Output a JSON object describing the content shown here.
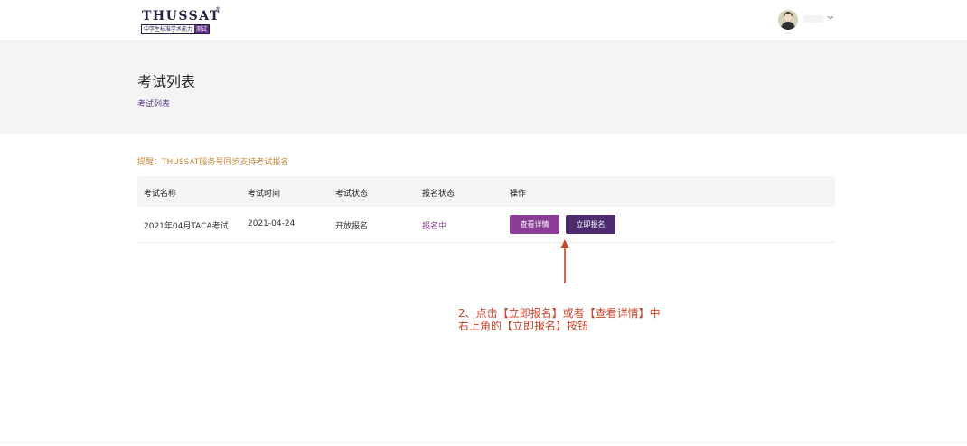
{
  "header": {
    "logo": {
      "brand": "THUSSAT",
      "registered": "®",
      "subtitle": "中学生标准学术能力",
      "subtitle_tag": "测试"
    },
    "user_menu": {
      "avatar_icon": "user-avatar-icon",
      "dropdown_icon": "chevron-down-icon"
    }
  },
  "banner": {
    "title": "考试列表",
    "breadcrumb": "考试列表"
  },
  "notice": "提醒：THUSSAT服务号同步支持考试报名",
  "table": {
    "columns": [
      "考试名称",
      "考试时间",
      "考试状态",
      "报名状态",
      "操作"
    ],
    "rows": [
      {
        "name": "2021年04月TACA考试",
        "date": "2021-04-24",
        "exam_status": "开放报名",
        "signup_status": "报名中",
        "actions": {
          "detail": "查看详情",
          "signup": "立即报名"
        }
      }
    ]
  },
  "annotation": {
    "line1": "2、点击【立即报名】或者【查看详情】中",
    "line2": "右上角的【立即报名】按钮",
    "color": "#c9452b"
  },
  "colors": {
    "brand": "#5b2c83",
    "primary_button": "#8a3d97",
    "secondary_button": "#4e2a6f",
    "notice": "#c8893a"
  }
}
